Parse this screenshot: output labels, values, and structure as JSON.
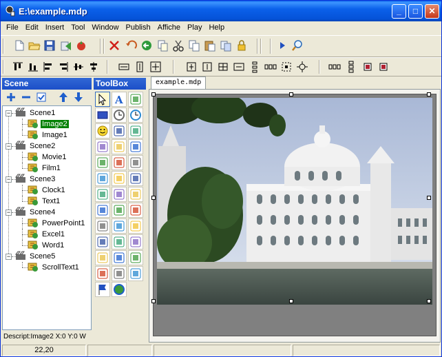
{
  "window": {
    "title": "E:\\example.mdp",
    "min_label": "_",
    "max_label": "□",
    "close_label": "✕"
  },
  "menu": [
    "File",
    "Edit",
    "Insert",
    "Tool",
    "Window",
    "Publish",
    "Affiche",
    "Play",
    "Help"
  ],
  "toolbar1": {
    "icons": [
      "new-file-icon",
      "open-folder-icon",
      "save-icon",
      "publish-icon",
      "build-icon",
      "delete-icon",
      "undo-icon",
      "paste-special-icon",
      "cut-icon",
      "copy-icon",
      "paste-icon",
      "clipboard-icon",
      "lock-icon",
      "play-icon",
      "preview-icon"
    ]
  },
  "toolbar2": {
    "icons": [
      "align-top-icon",
      "align-bottom-icon",
      "align-left-icon",
      "align-right-icon",
      "align-center-v-icon",
      "align-center-h-icon",
      "same-width-icon",
      "same-height-icon",
      "same-size-icon",
      "bring-forward-icon",
      "send-backward-icon",
      "group-icon",
      "space-v-icon",
      "space-h-icon",
      "fit-icon",
      "center-icon",
      "distribute-h-icon",
      "distribute-v-icon",
      "bring-front-icon",
      "send-back-icon"
    ]
  },
  "scene_panel": {
    "title": "Scene",
    "tools": [
      "add-icon",
      "remove-icon",
      "check-icon",
      "move-up-icon",
      "move-down-icon"
    ],
    "tree": [
      {
        "label": "Scene1",
        "level": 0,
        "type": "scene"
      },
      {
        "label": "Image2",
        "level": 1,
        "type": "item",
        "selected": true
      },
      {
        "label": "Image1",
        "level": 1,
        "type": "item"
      },
      {
        "label": "Scene2",
        "level": 0,
        "type": "scene"
      },
      {
        "label": "Movie1",
        "level": 1,
        "type": "item"
      },
      {
        "label": "Film1",
        "level": 1,
        "type": "item"
      },
      {
        "label": "Scene3",
        "level": 0,
        "type": "scene"
      },
      {
        "label": "Clock1",
        "level": 1,
        "type": "item"
      },
      {
        "label": "Text1",
        "level": 1,
        "type": "item"
      },
      {
        "label": "Scene4",
        "level": 0,
        "type": "scene"
      },
      {
        "label": "PowerPoint1",
        "level": 1,
        "type": "item"
      },
      {
        "label": "Excel1",
        "level": 1,
        "type": "item"
      },
      {
        "label": "Word1",
        "level": 1,
        "type": "item"
      },
      {
        "label": "Scene5",
        "level": 0,
        "type": "scene"
      },
      {
        "label": "ScrollText1",
        "level": 1,
        "type": "item"
      }
    ],
    "description": "Descript:Image2 X:0 Y:0 W"
  },
  "toolbox": {
    "title": "ToolBox",
    "tools": [
      "pointer-icon",
      "text-icon",
      "image-icon",
      "rectangle-icon",
      "clock-icon",
      "timer-icon",
      "smiley-icon",
      "font-icon",
      "table-icon",
      "document-icon",
      "page-icon",
      "picture-icon",
      "shapes-icon",
      "flash-icon",
      "music-icon",
      "html-icon",
      "browser-icon",
      "video-icon",
      "film-icon",
      "disc-icon",
      "comment-icon",
      "grid-icon",
      "word-icon",
      "excel-icon",
      "powerpoint-icon",
      "database-icon",
      "db-table-icon",
      "db-stack-icon",
      "db-grid-icon",
      "list-icon",
      "pencil-icon",
      "spreadsheet-icon",
      "list-view-icon",
      "clipboard-icon",
      "arrow-right-icon",
      "clip-icon",
      "flag-icon",
      "globe-icon"
    ]
  },
  "editor": {
    "tab_label": "example.mdp"
  },
  "statusbar": {
    "coords": "22,20"
  },
  "colors": {
    "title_bar": "#0b61ea",
    "panel_header": "#3168d5",
    "selection": "#008000",
    "stage": "#808080"
  }
}
